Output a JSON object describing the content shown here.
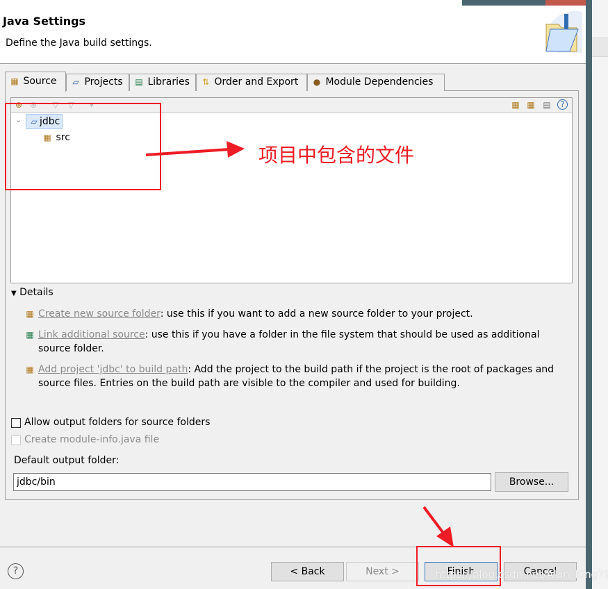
{
  "header": {
    "title": "Java Settings",
    "subtitle": "Define the Java build settings.",
    "icon": "java-folder-icon"
  },
  "tabs": [
    {
      "label": "Source",
      "icon": "source-folder-icon",
      "active": true
    },
    {
      "label": "Projects",
      "icon": "project-folder-icon"
    },
    {
      "label": "Libraries",
      "icon": "libraries-icon"
    },
    {
      "label": "Order and Export",
      "icon": "order-export-icon"
    },
    {
      "label": "Module Dependencies",
      "icon": "module-icon"
    }
  ],
  "tree": {
    "items": [
      {
        "label": "jdbc",
        "expanded": true,
        "selected": true
      },
      {
        "label": "src"
      }
    ]
  },
  "details": {
    "label": "Details",
    "items": [
      {
        "link": "Create new source folder",
        "text": ": use this if you want to add a new source folder to your project."
      },
      {
        "link": "Link additional source",
        "text": ": use this if you have a folder in the file system that should be used as additional source folder."
      },
      {
        "link": "Add project 'jdbc' to build path",
        "text": ": Add the project to the build path if the project is the root of packages and source files. Entries on the build path are visible to the compiler and used for building."
      }
    ]
  },
  "options": {
    "allow_output": {
      "label": "Allow output folders for source folders",
      "checked": false
    },
    "module_info": {
      "label": "Create module-info.java file",
      "checked": false,
      "disabled": true
    }
  },
  "output": {
    "label": "Default output folder:",
    "value": "jdbc/bin",
    "browse": "Browse..."
  },
  "buttons": {
    "back": "< Back",
    "next": "Next >",
    "finish": "Finish",
    "cancel": "Cancel"
  },
  "annotation": {
    "text": "项目中包含的文件",
    "color": "#ee1c25"
  },
  "watermark": "https://blog.csdn.net/Alan_King79"
}
